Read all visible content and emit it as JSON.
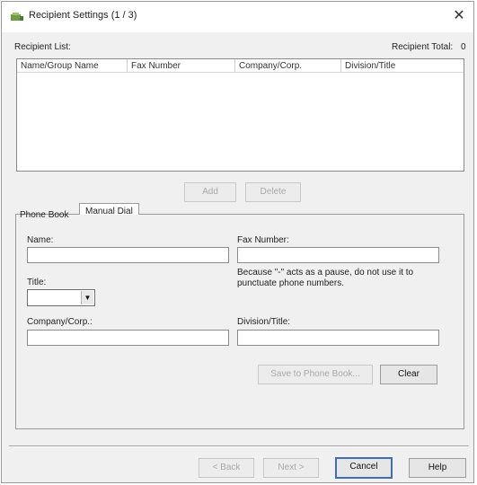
{
  "window": {
    "title": "Recipient Settings (1 / 3)",
    "close_glyph": "✕"
  },
  "recipient_list": {
    "label": "Recipient List:",
    "total_label": "Recipient Total:",
    "total_value": "0",
    "columns": [
      "Name/Group Name",
      "Fax Number",
      "Company/Corp.",
      "Division/Title"
    ]
  },
  "list_buttons": {
    "add": "Add",
    "delete": "Delete"
  },
  "tabs": [
    "Phone Book",
    "Manual Dial"
  ],
  "form": {
    "name_label": "Name:",
    "fax_label": "Fax Number:",
    "fax_note": "Because \"-\" acts as a pause, do not use it to punctuate phone numbers.",
    "title_label": "Title:",
    "title_value": "",
    "company_label": "Company/Corp.:",
    "division_label": "Division/Title:",
    "save_button": "Save to Phone Book...",
    "clear_button": "Clear"
  },
  "footer": {
    "back": "< Back",
    "next": "Next >",
    "cancel": "Cancel",
    "help": "Help"
  },
  "icons": {
    "app": "fax-app-icon",
    "dropdown": "chevron-down-icon",
    "close": "close-icon"
  }
}
